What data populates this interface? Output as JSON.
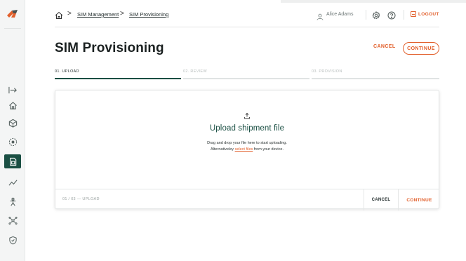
{
  "colors": {
    "accent": "#e2602c",
    "brand_dark": "#1a4f43",
    "sidebar_bg": "#f4f5f5"
  },
  "sidebar": {
    "items": [
      {
        "icon": "expand-icon"
      },
      {
        "icon": "home-icon"
      },
      {
        "icon": "cube-icon"
      },
      {
        "icon": "radar-icon"
      },
      {
        "icon": "sim-card-icon",
        "active": true
      },
      {
        "icon": "analytics-icon"
      },
      {
        "icon": "person-icon"
      },
      {
        "icon": "network-icon"
      },
      {
        "icon": "shield-icon"
      }
    ]
  },
  "breadcrumb": {
    "items": [
      "SIM Management",
      "SIM Provisioning"
    ],
    "separator": ">"
  },
  "header": {
    "user_name": "Alice Adams",
    "logout_label": "LOGOUT"
  },
  "page": {
    "title": "SIM Provisioning",
    "cancel_label": "CANCEL",
    "continue_label": "CONTINUE"
  },
  "steps": [
    {
      "label": "01. UPLOAD",
      "active": true
    },
    {
      "label": "02. REVIEW",
      "active": false
    },
    {
      "label": "03. PROVISION",
      "active": false
    }
  ],
  "upload": {
    "title": "Upload shipment file",
    "line1": "Drag and drop your file here to start uploading.",
    "line2_prefix": "Alternativeley",
    "line2_link": "select files",
    "line2_suffix": "from your device."
  },
  "footer": {
    "step_text": "01 / 03 — UPLOAD",
    "cancel_label": "CANCEL",
    "continue_label": "CONTINUE"
  }
}
